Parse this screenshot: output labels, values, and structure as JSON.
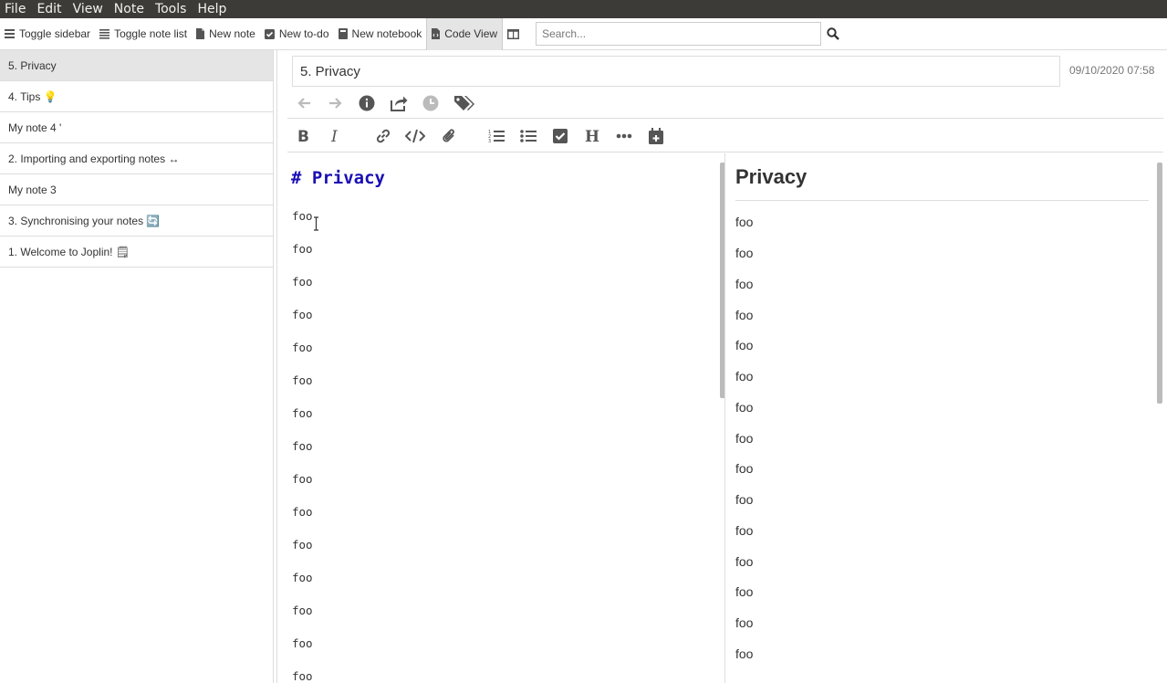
{
  "menubar": {
    "items": [
      "File",
      "Edit",
      "View",
      "Note",
      "Tools",
      "Help"
    ]
  },
  "toolbar": {
    "toggle_sidebar": "Toggle sidebar",
    "toggle_note_list": "Toggle note list",
    "new_note": "New note",
    "new_todo": "New to-do",
    "new_notebook": "New notebook",
    "code_view": "Code View",
    "search_placeholder": "Search..."
  },
  "note_list": {
    "items": [
      {
        "title": "5. Privacy",
        "selected": true
      },
      {
        "title": "4. Tips 💡"
      },
      {
        "title": "My note 4 '"
      },
      {
        "title": "2. Importing and exporting notes ↔"
      },
      {
        "title": "My note 3"
      },
      {
        "title": "3. Synchronising your notes 🔄"
      },
      {
        "title": "1. Welcome to Joplin! 🗒"
      }
    ]
  },
  "note": {
    "title": "5. Privacy",
    "date": "09/10/2020 07:58"
  },
  "editor": {
    "heading": "# Privacy",
    "lines": [
      "foo",
      "foo",
      "foo",
      "foo",
      "foo",
      "foo",
      "foo",
      "foo",
      "foo",
      "foo",
      "foo",
      "foo",
      "foo",
      "foo",
      "foo"
    ]
  },
  "preview": {
    "heading": "Privacy",
    "lines": [
      "foo",
      "foo",
      "foo",
      "foo",
      "foo",
      "foo",
      "foo",
      "foo",
      "foo",
      "foo",
      "foo",
      "foo",
      "foo",
      "foo",
      "foo"
    ]
  }
}
